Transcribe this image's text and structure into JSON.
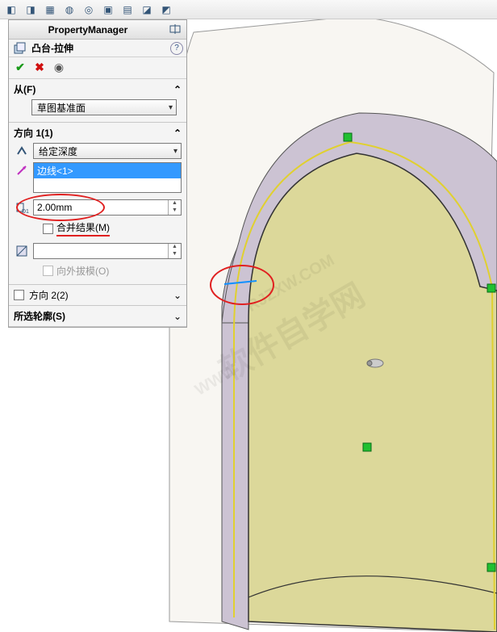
{
  "toolbar_icons": [
    "icon1",
    "icon2",
    "icon3",
    "icon4",
    "icon5",
    "icon6",
    "icon7",
    "icon8",
    "icon9",
    "icon10"
  ],
  "panel": {
    "title": "PropertyManager",
    "feature_name": "凸台-拉伸",
    "help_label": "?"
  },
  "from_section": {
    "label": "从(F)",
    "combo_value": "草图基准面"
  },
  "dir1_section": {
    "label": "方向 1(1)",
    "end_condition": "给定深度",
    "selected_edge": "边线<1>",
    "depth_value": "2.00mm",
    "merge_label": "合并结果(M)",
    "draft_value": "",
    "draft_outward_label": "向外拔模(O)"
  },
  "dir2_section": {
    "label": "方向 2(2)"
  },
  "contours_section": {
    "label": "所选轮廓(S)"
  },
  "watermark_main": "软件自学网",
  "watermark_url": "RJZXW.COM",
  "watermark_en": "WWW"
}
